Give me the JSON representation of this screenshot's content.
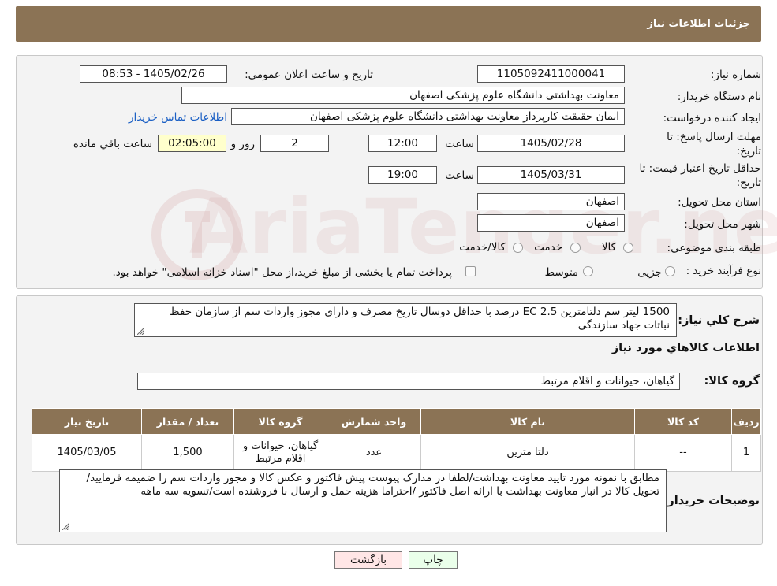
{
  "header": {
    "title": "جزئیات اطلاعات نیاز"
  },
  "form": {
    "need_number": {
      "label": "شماره نیاز:",
      "value": "1105092411000041"
    },
    "announce_datetime": {
      "label": "تاریخ و ساعت اعلان عمومی:",
      "value": "1405/02/26 - 08:53"
    },
    "buyer_org": {
      "label": "نام دستگاه خریدار:",
      "value": "معاونت بهداشتی دانشگاه علوم پزشکی اصفهان"
    },
    "requester": {
      "label": "ایجاد کننده درخواست:",
      "value": "ایمان حقیقت کارپرداز معاونت بهداشتی دانشگاه علوم پزشکی اصفهان",
      "contact_link": "اطلاعات تماس خریدار"
    },
    "reply_deadline": {
      "label_line1": "مهلت ارسال پاسخ: تا",
      "label_line2": "تاریخ:",
      "date": "1405/02/28",
      "time_label": "ساعت",
      "time": "12:00",
      "days": "2",
      "days_label": "روز و",
      "remaining": "02:05:00",
      "remaining_label": "ساعت باقي مانده"
    },
    "price_validity": {
      "label_line1": "حداقل تاریخ اعتبار قیمت: تا",
      "label_line2": "تاریخ:",
      "date": "1405/03/31",
      "time_label": "ساعت",
      "time": "19:00"
    },
    "delivery_province": {
      "label": "استان محل تحویل:",
      "value": "اصفهان"
    },
    "delivery_city": {
      "label": "شهر محل تحویل:",
      "value": "اصفهان"
    },
    "category": {
      "label": "طبقه بندی موضوعی:",
      "options": [
        "کالا",
        "خدمت",
        "کالا/خدمت"
      ]
    },
    "purchase_type": {
      "label": "نوع فرآیند خرید :",
      "options": [
        "جزیی",
        "متوسط"
      ],
      "note": "پرداخت تمام یا بخشی از مبلغ خرید،از محل \"اسناد خزانه اسلامی\" خواهد بود."
    }
  },
  "description": {
    "label": "شرح كلي نياز:",
    "value": "1500 لیتر سم دلتامترین EC 2.5 درصد با حداقل دوسال تاریخ مصرف و دارای مجوز واردات سم از سازمان حفظ نباتات جهاد سازندگی"
  },
  "goods": {
    "section_title": "اطلاعات كالاهاي مورد نياز",
    "group_label": "گروه كالا:",
    "group_value": "گیاهان، حیوانات و اقلام مرتبط",
    "table": {
      "headers": [
        "رديف",
        "كد كالا",
        "نام كالا",
        "واحد شمارش",
        "گروه كالا",
        "تعداد / مقدار",
        "تاريخ نياز"
      ],
      "rows": [
        [
          "1",
          "--",
          "دلتا مترین",
          "عدد",
          "گیاهان، حیوانات و اقلام مرتبط",
          "1,500",
          "1405/03/05"
        ]
      ]
    }
  },
  "buyer_notes": {
    "label": "توضيحات خريدار:",
    "value": "مطابق با نمونه مورد تایید معاونت بهداشت/لطفا در مدارک پیوست پیش فاکتور و عکس کالا و مجوز واردات سم را ضمیمه فرمایید/تحویل کالا در انبار معاونت بهداشت با ارائه اصل فاکتور /احتراما هزینه حمل و ارسال با فروشنده است/تسویه سه ماهه"
  },
  "buttons": {
    "print": "چاپ",
    "back": "بازگشت"
  },
  "watermark": "AriaTender.neT"
}
